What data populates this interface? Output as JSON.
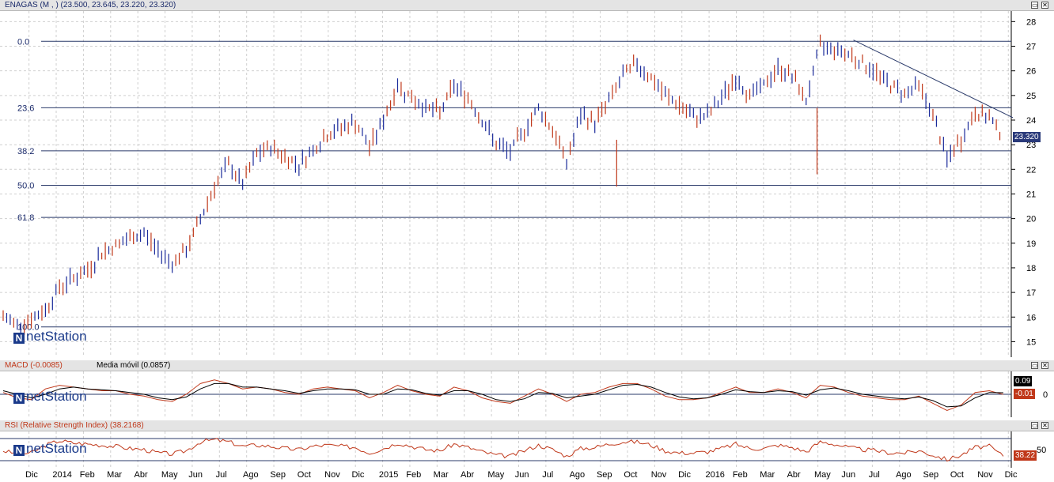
{
  "panes": {
    "price": {
      "title": "ENAGAS (M , ) (23.500, 23.645, 23.220, 23.320)"
    },
    "macd": {
      "title": "MACD (-0.0085)",
      "subtitle": "Media móvil (0.0857)"
    },
    "rsi": {
      "title": "RSI (Relative Strength Index) (38.2168)"
    }
  },
  "logo_text": "netStation",
  "logo_mark": "N",
  "window_icons": [
    "restore-icon",
    "close-icon"
  ],
  "colors": {
    "up": "#1a2a9a",
    "down": "#c0381a",
    "price_badge": "#2a3a7a",
    "grid": "#cccccc",
    "header": "#e4e4e4"
  },
  "chart_data": [
    {
      "type": "line",
      "subtype": "ohlc-bars",
      "title": "ENAGAS (M , ) (23.500, 23.645, 23.220, 23.320)",
      "last": {
        "open": 23.5,
        "high": 23.645,
        "low": 23.22,
        "close": 23.32
      },
      "last_label": "23.320",
      "x_labels": [
        "Dic",
        "2014",
        "Feb",
        "Mar",
        "Abr",
        "May",
        "Jun",
        "Jul",
        "Ago",
        "Sep",
        "Oct",
        "Nov",
        "Dic",
        "2015",
        "Feb",
        "Mar",
        "Abr",
        "May",
        "Jun",
        "Jul",
        "Ago",
        "Sep",
        "Oct",
        "Nov",
        "Dic",
        "2016",
        "Feb",
        "Mar",
        "Abr",
        "May",
        "Jun",
        "Jul",
        "Ago",
        "Sep",
        "Oct",
        "Nov",
        "Dic"
      ],
      "ylim": [
        14.5,
        28.3
      ],
      "y_ticks": [
        15,
        16,
        17,
        18,
        19,
        20,
        21,
        22,
        23,
        24,
        25,
        26,
        27,
        28
      ],
      "y_axis": "right",
      "grid": true,
      "series": [
        {
          "values": [
            16.0,
            15.7,
            15.9,
            16.3,
            17.2,
            17.6,
            17.9,
            18.6,
            18.9,
            19.2,
            19.4,
            18.7,
            18.2,
            18.7,
            20.0,
            21.3,
            22.2,
            21.4,
            22.6,
            22.9,
            22.5,
            22.2,
            22.8,
            23.4,
            23.7,
            23.9,
            22.9,
            24.0,
            25.4,
            24.9,
            24.5,
            24.3,
            25.4,
            24.9,
            24.0,
            23.0,
            22.7,
            23.6,
            24.5,
            23.6,
            22.3,
            24.2,
            23.9,
            24.8,
            25.8,
            26.3,
            25.7,
            25.0,
            24.6,
            24.1,
            24.2,
            24.9,
            25.7,
            25.0,
            25.4,
            26.1,
            25.8,
            24.8,
            27.0,
            26.9,
            26.7,
            26.3,
            25.9,
            25.4,
            25.1,
            25.4,
            24.2,
            22.4,
            23.2,
            24.3,
            24.1,
            23.3
          ]
        }
      ],
      "fibonacci": {
        "levels": [
          {
            "label": "0.0",
            "price": 27.2
          },
          {
            "label": "23.6",
            "price": 24.5
          },
          {
            "label": "38.2",
            "price": 22.75
          },
          {
            "label": "50.0",
            "price": 21.35
          },
          {
            "label": "61.8",
            "price": 20.05
          },
          {
            "label": "100.0",
            "price": 15.6
          }
        ]
      },
      "trendline": {
        "from": {
          "index": 58,
          "value": 27.25
        },
        "to": {
          "index": 71,
          "value": 24.1
        }
      }
    },
    {
      "type": "line",
      "title": "MACD (-0.0085)",
      "ylim": [
        -1.1,
        1.1
      ],
      "y_ticks": [
        0
      ],
      "grid": true,
      "badges": {
        "signal": "0.09",
        "macd": "-0.01"
      },
      "series": [
        {
          "name": "MACD (-0.0085)",
          "values": [
            0.1,
            -0.2,
            -0.3,
            0.3,
            0.5,
            0.4,
            0.3,
            0.2,
            0.2,
            0.0,
            -0.1,
            -0.3,
            -0.4,
            0.0,
            0.6,
            0.8,
            0.6,
            0.3,
            0.4,
            0.3,
            0.1,
            0.0,
            0.3,
            0.4,
            0.3,
            0.2,
            -0.2,
            0.1,
            0.5,
            0.2,
            0.0,
            -0.1,
            0.4,
            0.2,
            -0.2,
            -0.4,
            -0.5,
            -0.1,
            0.3,
            0.0,
            -0.4,
            0.0,
            0.1,
            0.4,
            0.6,
            0.6,
            0.3,
            -0.1,
            -0.3,
            -0.3,
            -0.2,
            0.1,
            0.4,
            0.1,
            0.1,
            0.3,
            0.1,
            -0.2,
            0.5,
            0.4,
            0.1,
            -0.1,
            -0.2,
            -0.3,
            -0.3,
            -0.1,
            -0.5,
            -0.9,
            -0.6,
            0.1,
            0.2,
            -0.01
          ]
        },
        {
          "name": "Media móvil (0.0857)",
          "values": [
            0.2,
            0.0,
            -0.2,
            0.0,
            0.3,
            0.4,
            0.3,
            0.25,
            0.2,
            0.1,
            0.0,
            -0.2,
            -0.3,
            -0.15,
            0.3,
            0.6,
            0.6,
            0.4,
            0.4,
            0.3,
            0.2,
            0.05,
            0.2,
            0.3,
            0.3,
            0.25,
            0.0,
            0.0,
            0.3,
            0.25,
            0.05,
            -0.05,
            0.2,
            0.2,
            0.0,
            -0.3,
            -0.4,
            -0.25,
            0.1,
            0.05,
            -0.2,
            -0.1,
            0.0,
            0.25,
            0.5,
            0.55,
            0.4,
            0.1,
            -0.15,
            -0.25,
            -0.2,
            0.0,
            0.25,
            0.15,
            0.1,
            0.2,
            0.15,
            -0.05,
            0.25,
            0.35,
            0.2,
            0.0,
            -0.1,
            -0.2,
            -0.25,
            -0.15,
            -0.35,
            -0.7,
            -0.65,
            -0.2,
            0.1,
            0.09
          ]
        }
      ]
    },
    {
      "type": "line",
      "title": "RSI (Relative Strength Index) (38.2168)",
      "ylim": [
        20,
        80
      ],
      "y_ticks": [
        50
      ],
      "grid": true,
      "badge": "38.22",
      "series": [
        {
          "name": "RSI (Relative Strength Index) (38.2168)",
          "values": [
            48,
            42,
            44,
            58,
            66,
            62,
            60,
            58,
            56,
            52,
            50,
            44,
            42,
            48,
            64,
            68,
            64,
            56,
            58,
            56,
            52,
            50,
            56,
            58,
            56,
            54,
            44,
            52,
            62,
            56,
            50,
            48,
            60,
            54,
            46,
            40,
            38,
            48,
            58,
            50,
            38,
            52,
            54,
            60,
            64,
            64,
            58,
            48,
            44,
            44,
            46,
            52,
            60,
            52,
            52,
            58,
            54,
            46,
            64,
            60,
            54,
            50,
            48,
            44,
            44,
            48,
            40,
            32,
            40,
            54,
            56,
            38
          ]
        }
      ]
    }
  ]
}
